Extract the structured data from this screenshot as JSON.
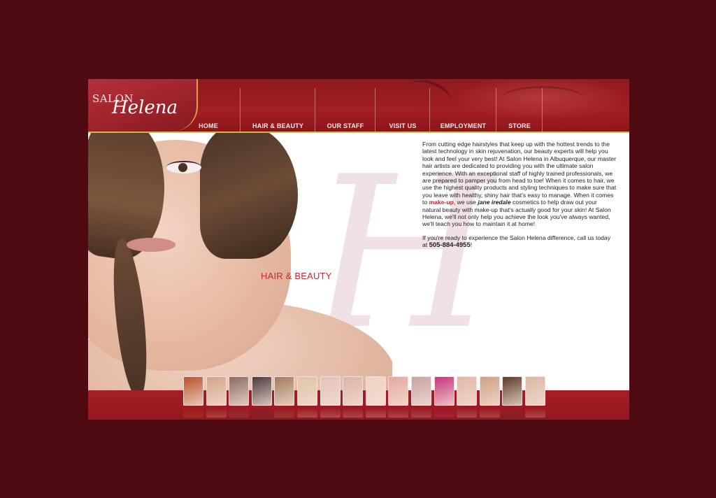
{
  "logo": {
    "line1": "SALON",
    "line2": "Helena"
  },
  "nav": {
    "items": [
      "HOME",
      "HAIR & BEAUTY",
      "OUR STAFF",
      "VISIT US",
      "EMPLOYMENT",
      "STORE"
    ]
  },
  "hero": {
    "label": "HAIR & BEAUTY",
    "watermark": "H"
  },
  "content": {
    "p1_a": "From cutting edge hairstyles that keep up with the hottest trends to the latest technology in skin rejuvenation, our beauty experts will help you look and feel your very best! At Salon Helena in Albuquerque, our master hair artists are dedicated to providing you with the ultimate salon experience. With an exceptional staff of highly trained professionals, we are prepared to pamper you from head to toe! When it comes to hair, we use the highest quality products and styling techniques to make sure that you leave with healthy, shiny hair that's easy to manage. When it comes to ",
    "p1_link": "make-up",
    "p1_b": ", we use ",
    "p1_brand": "jane iredale",
    "p1_c": " cosmetics to help draw out your natural beauty with make-up that's actually good for your skin! At Salon Helena, we'll not only help you achieve the look you've always wanted, we'll teach you how to maintain it at home!",
    "p2_a": "If you're ready to experience the Salon Helena difference, call us today at ",
    "p2_phone": "505-884-4955",
    "p2_b": "!"
  },
  "thumbnails": [
    {
      "name": "thumb-red-hair",
      "color": "#b9512a"
    },
    {
      "name": "thumb-woman-closed-eyes",
      "color": "#d3a488"
    },
    {
      "name": "thumb-child-haircut",
      "color": "#8a6b63"
    },
    {
      "name": "thumb-stylist",
      "color": "#4a3a3d"
    },
    {
      "name": "thumb-smiling-woman",
      "color": "#a37a5c"
    },
    {
      "name": "thumb-blonde-woman",
      "color": "#dcc5a5"
    },
    {
      "name": "thumb-hand-nails",
      "color": "#e3c2b8"
    },
    {
      "name": "thumb-feet",
      "color": "#dbb4a5"
    },
    {
      "name": "thumb-shoulder",
      "color": "#f0d4c5"
    },
    {
      "name": "thumb-lips",
      "color": "#e6a8a0"
    },
    {
      "name": "thumb-eye",
      "color": "#c5a4a6"
    },
    {
      "name": "thumb-makeup-eye",
      "color": "#c7347e"
    },
    {
      "name": "thumb-hands",
      "color": "#e0b7a6"
    },
    {
      "name": "thumb-woman-face",
      "color": "#cfa084"
    },
    {
      "name": "thumb-curly-hair",
      "color": "#5b3b2a"
    },
    {
      "name": "thumb-young-woman",
      "color": "#d9b8a3"
    }
  ],
  "colors": {
    "background": "#4e0a10",
    "brand_red": "#a31e25",
    "accent_gold": "#e0b046",
    "highlight": "#c5202c"
  }
}
